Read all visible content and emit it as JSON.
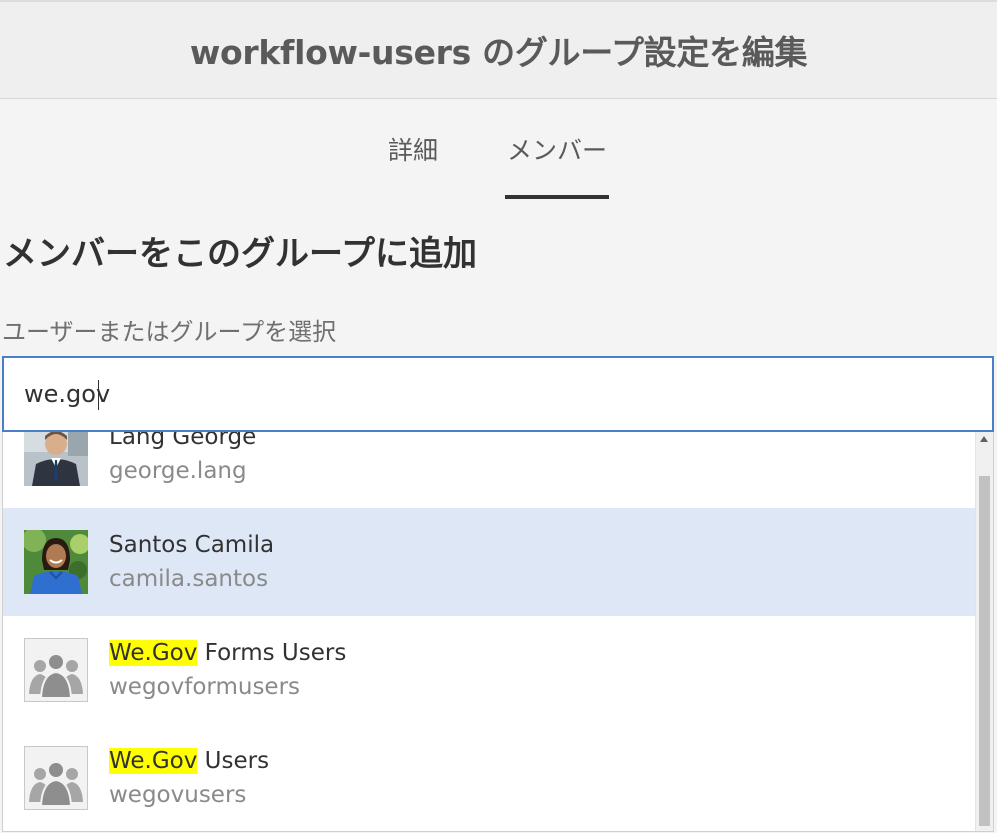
{
  "header": {
    "title": "workflow-users のグループ設定を編集"
  },
  "tabs": [
    {
      "label": "詳細",
      "active": false
    },
    {
      "label": "メンバー",
      "active": true
    }
  ],
  "section": {
    "title": "メンバーをこのグループに追加"
  },
  "member_picker": {
    "label": "ユーザーまたはグループを選択",
    "value": "we.gov"
  },
  "results": [
    {
      "name_highlight": "",
      "name": "Lang George",
      "id": "george.lang",
      "avatar": "user-photo",
      "selected": false
    },
    {
      "name_highlight": "",
      "name": "Santos Camila",
      "id": "camila.santos",
      "avatar": "user-photo",
      "selected": true
    },
    {
      "name_highlight": "We.Gov",
      "name": " Forms Users",
      "id": "wegovformusers",
      "avatar": "group-icon",
      "selected": false
    },
    {
      "name_highlight": "We.Gov",
      "name": " Users",
      "id": "wegovusers",
      "avatar": "group-icon",
      "selected": false
    }
  ],
  "colors": {
    "accent": "#4a7fc8",
    "selected_row": "#dde7f6",
    "highlight": "#ffff00"
  }
}
